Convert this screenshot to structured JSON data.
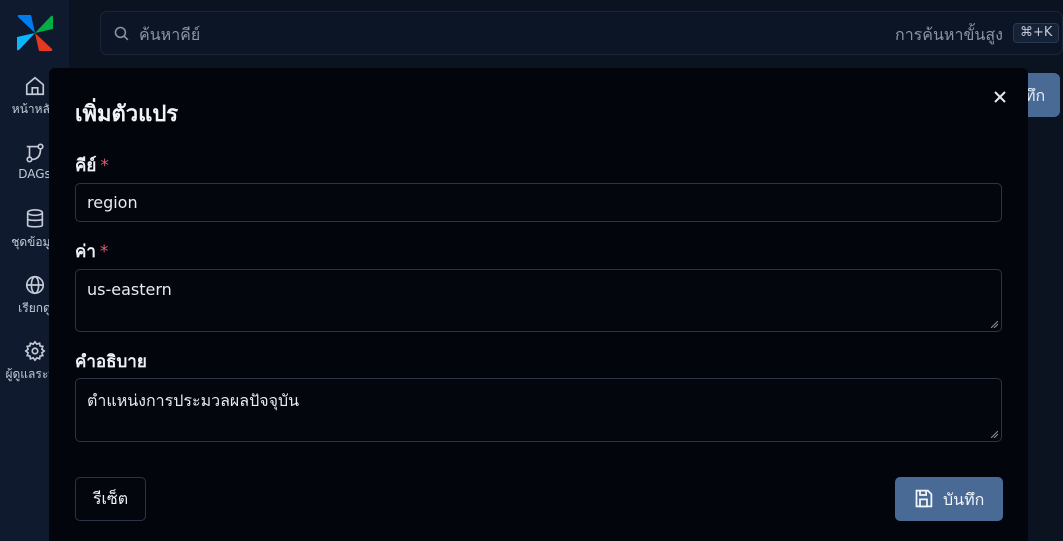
{
  "app": {
    "logo_icon": "airflow-pinwheel-logo",
    "brand_colors": [
      "#e43921",
      "#00ad46",
      "#0cb6ff",
      "#017cee"
    ]
  },
  "sidebar": {
    "items": [
      {
        "label": "หน้าหลัก",
        "icon": "home-icon"
      },
      {
        "label": "DAGs",
        "icon": "dags-icon"
      },
      {
        "label": "ชุดข้อมูล",
        "icon": "database-icon"
      },
      {
        "label": "เรียกดู",
        "icon": "globe-icon"
      },
      {
        "label": "ผู้ดูแลระบบ",
        "icon": "gear-icon"
      }
    ]
  },
  "header": {
    "search_placeholder": "ค้นหาคีย์",
    "advanced_search": "การค้นหาขั้นสูง",
    "shortcut": "⌘+K"
  },
  "background": {
    "save_partial": "ทึก"
  },
  "modal": {
    "title": "เพิ่มตัวแปร",
    "key_label": "คีย์",
    "key_value": "region",
    "value_label": "ค่า",
    "value_value": "us-eastern",
    "description_label": "คำอธิบาย",
    "description_value": "ตำแหน่งการประมวลผลปัจจุบัน",
    "required_mark": "*",
    "reset_label": "รีเซ็ต",
    "save_label": "บันทึก"
  },
  "colors": {
    "accent": "#4a6a96",
    "required": "#e05d6f",
    "modal_bg": "#02050c",
    "page_bg": "#0b1220"
  }
}
